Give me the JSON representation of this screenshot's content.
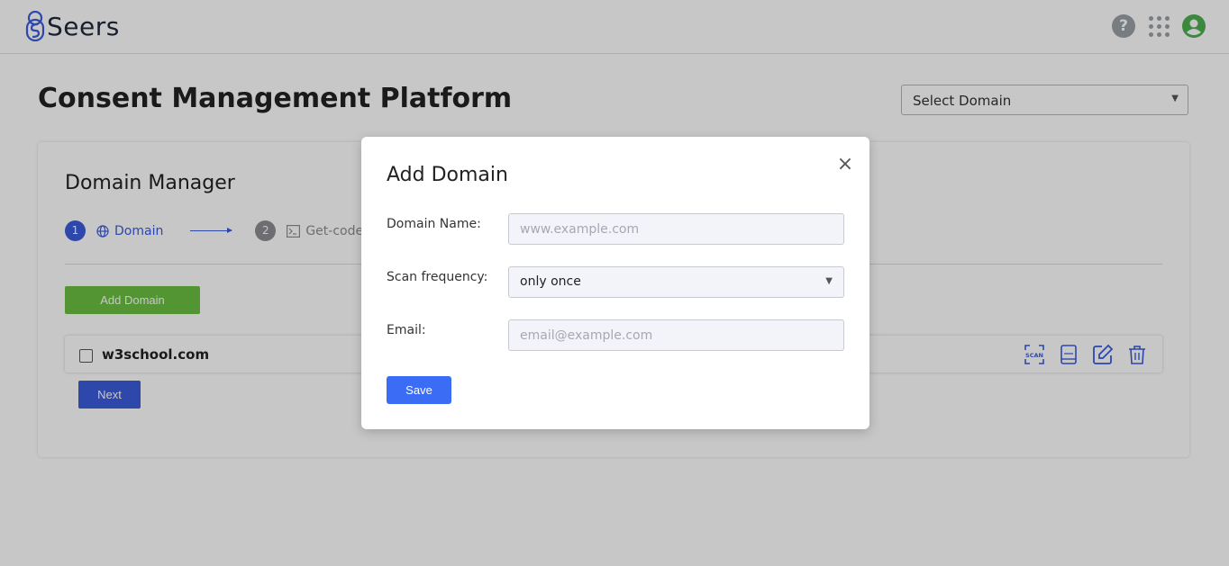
{
  "header": {
    "logo_text": "Seers",
    "icons": [
      "help-icon",
      "apps-grid-icon",
      "user-account-icon"
    ],
    "brand_color": "#3b5bdb"
  },
  "page": {
    "title": "Consent Management Platform",
    "domain_select": {
      "value": "Select Domain"
    }
  },
  "card": {
    "title": "Domain Manager",
    "steps": [
      {
        "number": "1",
        "label": "Domain",
        "icon": "globe-icon",
        "active": true
      },
      {
        "number": "2",
        "label": "Get-code",
        "icon": "terminal-icon",
        "active": false
      }
    ],
    "add_button": "Add Domain",
    "domains": [
      {
        "name": "w3school.com",
        "checked": false,
        "actions": [
          "scan-icon",
          "report-icon",
          "edit-icon",
          "delete-icon"
        ]
      }
    ],
    "next_button": "Next"
  },
  "modal": {
    "title": "Add Domain",
    "close_symbol": "×",
    "fields": {
      "domain_name": {
        "label": "Domain Name:",
        "placeholder": "www.example.com",
        "value": ""
      },
      "scan_frequency": {
        "label": "Scan frequency:",
        "value": "only once"
      },
      "email": {
        "label": "Email:",
        "placeholder": "email@example.com",
        "value": ""
      }
    },
    "save_button": "Save"
  },
  "colors": {
    "primary": "#3b5bdb",
    "success": "#6abf40",
    "save_button": "#3b6cf6",
    "user_icon": "#4caf50"
  }
}
